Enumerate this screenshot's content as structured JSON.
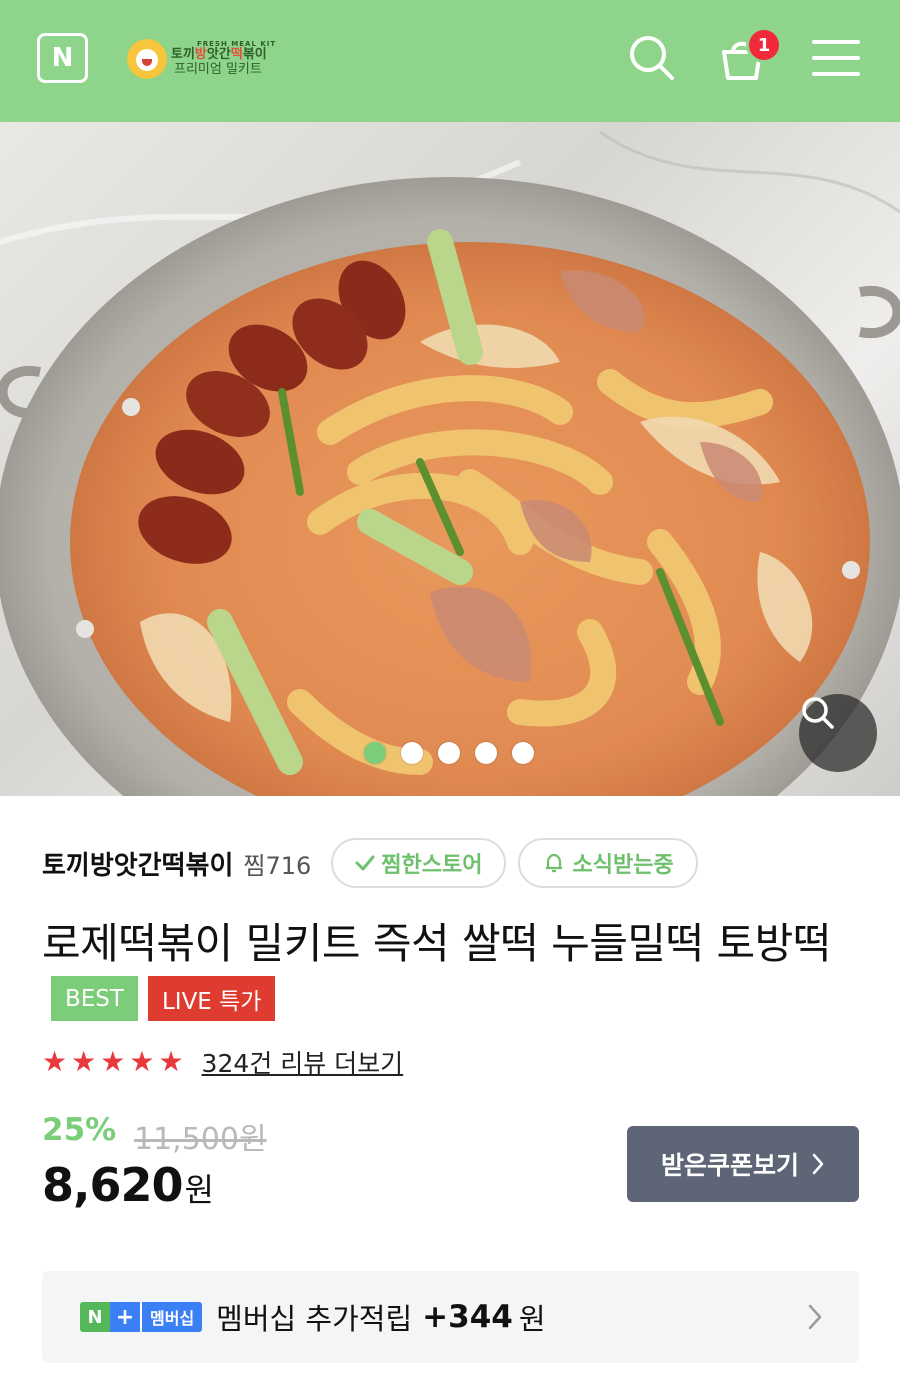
{
  "header": {
    "n_logo": "N",
    "store_logo_kit": "FRESH MEAL KIT",
    "store_logo_name_parts": [
      "토끼",
      "방",
      "앗간",
      "떡",
      "볶이"
    ],
    "store_logo_sub": "프리미엄 밀키트",
    "cart_count": "1",
    "icons": [
      "n-logo",
      "search-icon",
      "cart-icon",
      "menu-icon"
    ],
    "bg_color": "#8ed48a"
  },
  "hero": {
    "slide_count": 5,
    "active_slide": 1,
    "zoom_icon": "search-icon"
  },
  "store": {
    "name": "토끼방앗간떡볶이",
    "zzim": "찜716",
    "follow_label": "찜한스토어",
    "notify_label": "소식받는중"
  },
  "product": {
    "title": "로제떡볶이 밀키트 즉석 쌀떡 누들밀떡 토방떡",
    "tags": [
      "BEST",
      "LIVE 특가"
    ],
    "rating_stars": 5,
    "review_link": "324건 리뷰 더보기",
    "discount": "25%",
    "original_price": "11,500원",
    "price_value": "8,620",
    "price_unit": "원",
    "coupon_label": "받은쿠폰보기"
  },
  "membership": {
    "badge_n": "N",
    "badge_plus": "+",
    "badge_label": "멤버십",
    "text": "멤버십 추가적립",
    "amount": "+344",
    "unit": "원"
  },
  "colors": {
    "accent_green": "#7ccd7a",
    "live_red": "#e03b30",
    "star_red": "#e8393d",
    "coupon_btn": "#5e6576",
    "badge_red": "#f0293b"
  }
}
